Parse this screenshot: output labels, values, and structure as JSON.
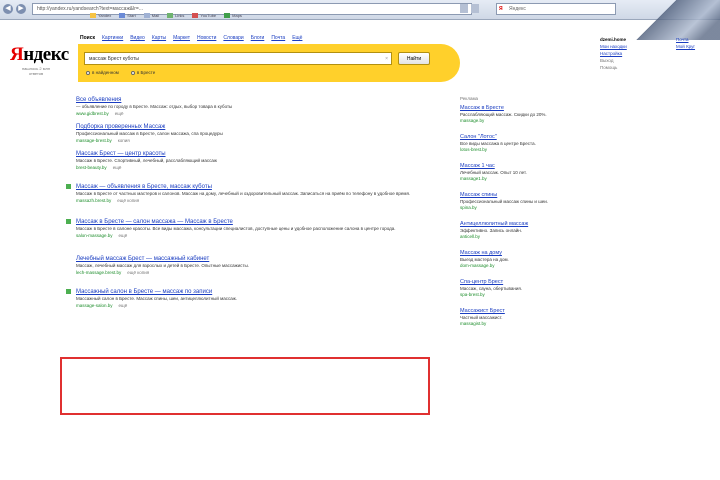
{
  "browser": {
    "url": "http://yandex.ru/yandsearch?text=массаж&lr=...",
    "tabs": [
      "Yandex",
      "Start",
      "Mail",
      "Links",
      "YouTube",
      "Maps"
    ],
    "search_placeholder": "Яндекс"
  },
  "yandex": {
    "logo_first": "Я",
    "logo_rest": "ндекс",
    "logo_sub": "нашлось 2 млн ответов",
    "services": [
      "Поиск",
      "Картинки",
      "Видео",
      "Карты",
      "Маркет",
      "Новости",
      "Словари",
      "Блоги",
      "Почта",
      "Ещё"
    ],
    "query": "массаж Брест куботы",
    "search_button": "Найти",
    "scope_options": [
      "в найденном",
      "в Бресте"
    ],
    "user": {
      "name": "dzemi.home",
      "links": [
        "Мои находки",
        "Настройка"
      ],
      "greys": [
        "Выход",
        "Помощь"
      ]
    },
    "right_links": [
      "Почта",
      "Мой Круг"
    ]
  },
  "results": [
    {
      "title": "Все объявления",
      "snippet": "— объявление по городу в Бресте. Массаж: отдых, выбор товара в куботы",
      "url": "www.gidbrest.by",
      "more": "ещё"
    },
    {
      "title": "Подборка проверенных Массаж",
      "snippet": "Профессиональный массаж в Бресте, салон массажа, спа процедуры",
      "url": "massage-brest.by",
      "more": "копия"
    },
    {
      "title": "Массаж Брест — центр красоты",
      "snippet": "Массаж в Бресте. Спортивный, лечебный, расслабляющий массаж",
      "url": "brest-beauty.by",
      "more": "ещё"
    },
    {
      "title": "Массаж — объявления в Бресте, массаж куботы",
      "snippet": "Массаж в Бресте от частных мастеров и салонов. Массаж на дому, лечебный и оздоровительный массаж. Записаться на приём по телефону в удобное время.",
      "url": "massazh.brest.by",
      "more": "ещё  копия"
    },
    {
      "title": "Массаж в Бресте — салон массажа — Массаж в Бресте",
      "snippet": "Массаж в Бресте в салоне красоты. Все виды массажа, консультации специалистов, доступные цены и удобное расположение салона в центре города.",
      "url": "salon-massage.by",
      "more": "ещё"
    },
    {
      "title": "Лечебный массаж Брест — массажный кабинет",
      "snippet": "Массаж, лечебный массаж для взрослых и детей в Бресте. Опытные массажисты.",
      "url": "lech-massage.brest.by",
      "more": "ещё  копия"
    },
    {
      "title": "Массажный салон в Бресте — массаж по записи",
      "snippet": "Массажный салон в Бресте. Массаж спины, шеи, антицеллюлитный массаж.",
      "url": "massage-salon.by",
      "more": "ещё"
    }
  ],
  "ads": {
    "header": "Реклама",
    "items": [
      {
        "title": "Массаж в Бресте",
        "desc": "Расслабляющий массаж. Скидки до 20%.",
        "url": "massage.by"
      },
      {
        "title": "Салон \"Лотос\"",
        "desc": "Все виды массажа в центре Бреста.",
        "url": "lotos-brest.by"
      },
      {
        "title": "Массаж 1 час",
        "desc": "Лечебный массаж. Опыт 10 лет.",
        "url": "massage1.by"
      },
      {
        "title": "Массаж спины",
        "desc": "Профессиональный массаж спины и шеи.",
        "url": "spina.by"
      },
      {
        "title": "Антицеллюлитный массаж",
        "desc": "Эффективно. Запись онлайн.",
        "url": "anticell.by"
      },
      {
        "title": "Массаж на дому",
        "desc": "Выезд мастера на дом.",
        "url": "dom-massage.by"
      },
      {
        "title": "Спа-центр Брест",
        "desc": "Массаж, сауна, обертывания.",
        "url": "spa-brest.by"
      },
      {
        "title": "Массажист Брест",
        "desc": "Частный массажист.",
        "url": "massagist.by"
      }
    ]
  }
}
